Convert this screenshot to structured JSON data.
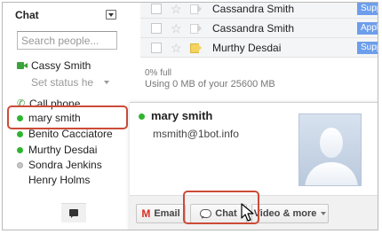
{
  "chat": {
    "title": "Chat",
    "search_placeholder": "Search people...",
    "self_name": "Cassy Smith",
    "status_placeholder": "Set status he",
    "call_phone_label": "Call phone",
    "contacts": [
      {
        "name": "mary smith",
        "status": "online"
      },
      {
        "name": "Benito Cacciatore",
        "status": "online"
      },
      {
        "name": "Murthy Desdai",
        "status": "online"
      },
      {
        "name": "Sondra Jenkins",
        "status": "offline"
      },
      {
        "name": "Henry Holms",
        "status": "none"
      }
    ]
  },
  "inbox": {
    "rows": [
      {
        "sender": "Cassandra Smith",
        "label": "Supp",
        "important": false
      },
      {
        "sender": "Cassandra Smith",
        "label": "Appli",
        "important": false
      },
      {
        "sender": "Murthy Desdai",
        "label": "Supp",
        "important": true
      }
    ],
    "quota_line1": "0% full",
    "quota_line2": "Using 0 MB of your 25600 MB"
  },
  "card": {
    "name": "mary smith",
    "email": "msmith@1bot.info",
    "email_button": "Email",
    "chat_button": "Chat",
    "video_button": "Video & more"
  },
  "colors": {
    "online": "#2fb52f",
    "highlight": "#cc4b38",
    "label": "#6d9eeb"
  }
}
